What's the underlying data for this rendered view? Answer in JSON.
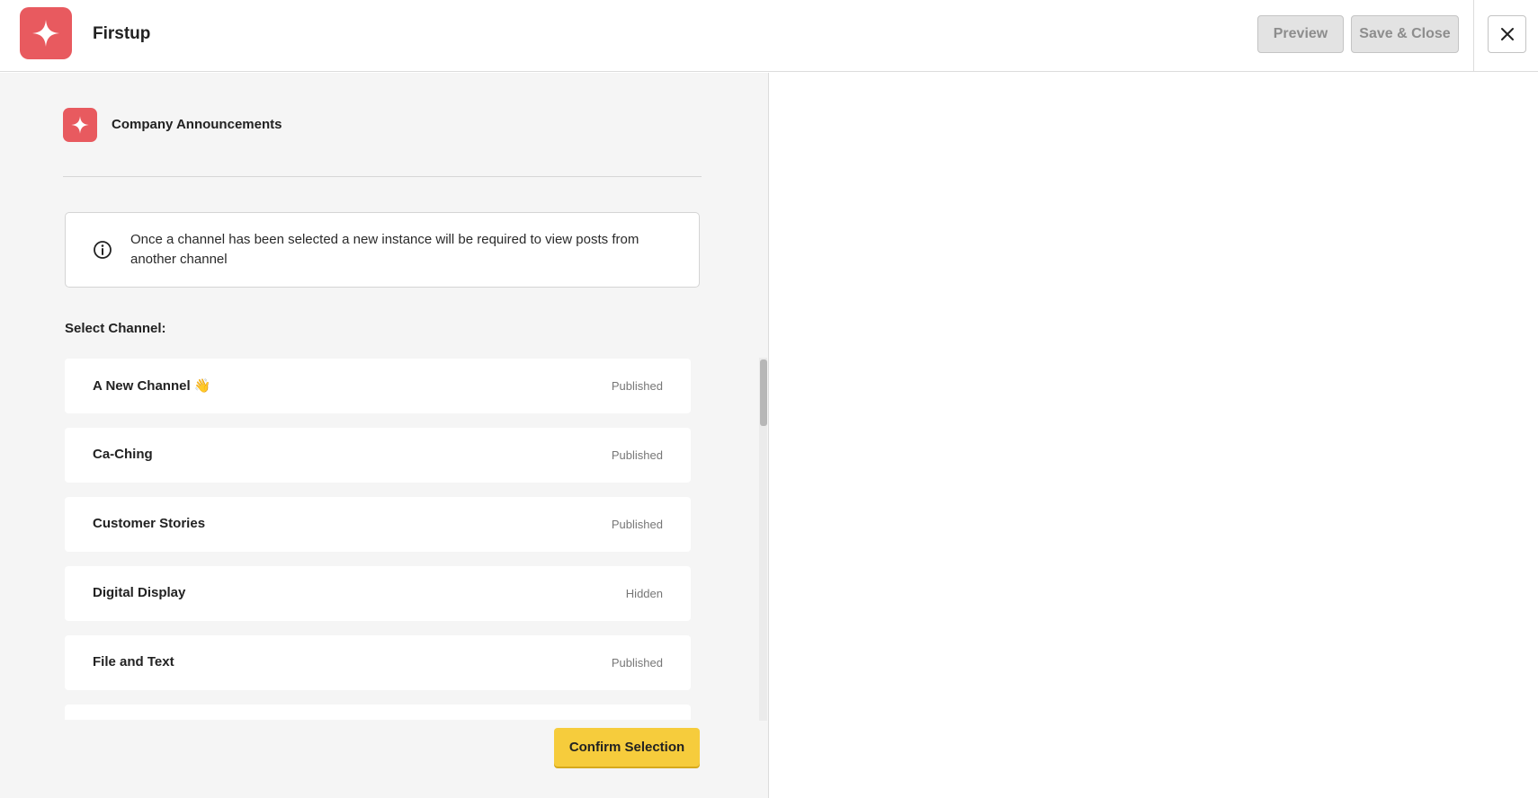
{
  "header": {
    "app_title": "Firstup",
    "preview_label": "Preview",
    "save_close_label": "Save & Close",
    "close_icon": "close-icon"
  },
  "channel_header": {
    "title": "Company Announcements"
  },
  "info": {
    "icon": "info-icon",
    "text": "Once a channel has been selected a new instance will be required to view posts from another channel"
  },
  "select": {
    "label": "Select Channel:",
    "channels": [
      {
        "name": "A New Channel 👋",
        "status": "Published"
      },
      {
        "name": "Ca-Ching",
        "status": "Published"
      },
      {
        "name": "Customer Stories",
        "status": "Published"
      },
      {
        "name": "Digital Display",
        "status": "Hidden"
      },
      {
        "name": "File and Text",
        "status": "Published"
      },
      {
        "name": "",
        "status": ""
      }
    ]
  },
  "footer": {
    "confirm_label": "Confirm Selection"
  },
  "colors": {
    "brand": "#e85a5f",
    "accent_button": "#f6cc3c",
    "panel_bg": "#f5f5f5"
  }
}
